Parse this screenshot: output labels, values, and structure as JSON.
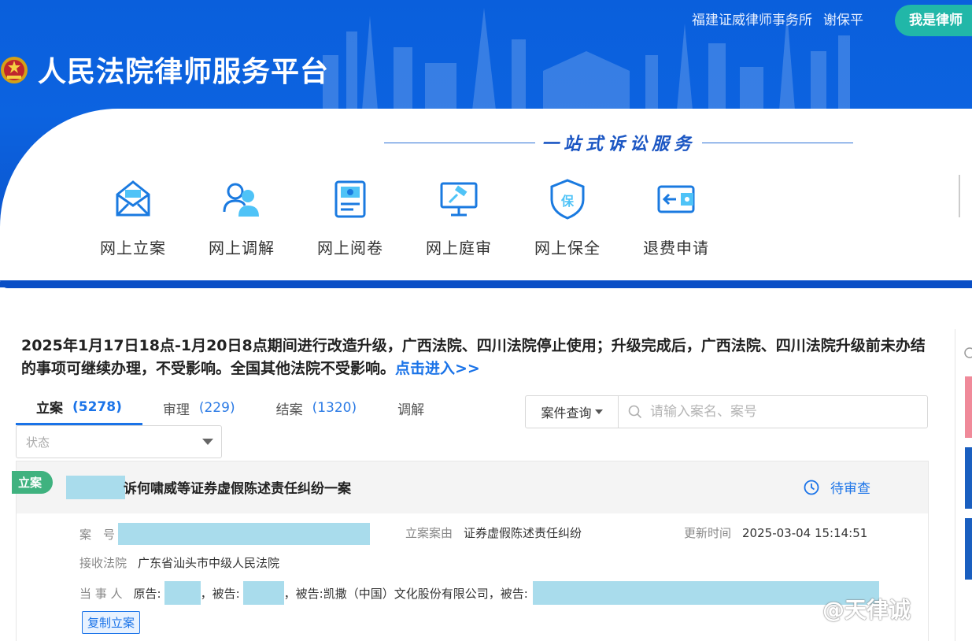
{
  "header": {
    "firm_name": "福建证威律师事务所",
    "user_name": "谢保平",
    "role_button": "我是律师",
    "platform_title": "人民法院律师服务平台",
    "slogan": "一站式诉讼服务"
  },
  "services": [
    {
      "label": "网上立案",
      "icon": "envelope-icon"
    },
    {
      "label": "网上调解",
      "icon": "people-icon"
    },
    {
      "label": "网上阅卷",
      "icon": "document-icon"
    },
    {
      "label": "网上庭审",
      "icon": "gavel-screen-icon"
    },
    {
      "label": "网上保全",
      "icon": "shield-icon"
    },
    {
      "label": "退费申请",
      "icon": "refund-icon"
    }
  ],
  "notice": {
    "text": "2025年1月17日18点-1月20日8点期间进行改造升级，广西法院、四川法院停止使用；升级完成后，广西法院、四川法院升级前未办结的事项可继续办理，不受影响。全国其他法院不受影响。",
    "link": "点击进入>>"
  },
  "tabs": [
    {
      "label": "立案",
      "count": "(5278)"
    },
    {
      "label": "审理",
      "count": "(229)"
    },
    {
      "label": "结案",
      "count": "(1320)"
    },
    {
      "label": "调解",
      "count": ""
    }
  ],
  "search": {
    "type": "案件查询",
    "placeholder": "请输入案名、案号"
  },
  "status_filter": {
    "placeholder": "状态"
  },
  "case": {
    "badge": "立案",
    "title": "诉何啸威等证券虚假陈述责任纠纷一案",
    "status": "待审查",
    "case_no_label": "案　号",
    "cause_label": "立案案由",
    "cause_value": "证券虚假陈述责任纠纷",
    "update_label": "更新时间",
    "update_value": "2025-03-04 15:14:51",
    "court_label": "接收法院",
    "court_value": "广东省汕头市中级人民法院",
    "party_label": "当 事 人",
    "plaintiff_prefix": "原告:",
    "plaintiff_suffix": "，被告:",
    "defendant_sep": "，被告:",
    "defendant_company": "凯撒（中国）文化股份有限公司，被告:",
    "copy_button": "复制立案"
  },
  "watermark": "@天律诚",
  "colors": {
    "brand_blue": "#0a5fdc",
    "accent_blue": "#1a73e8",
    "teal": "#21b7a8",
    "badge_green": "#3fb27f",
    "redaction": "#a9dcec"
  }
}
